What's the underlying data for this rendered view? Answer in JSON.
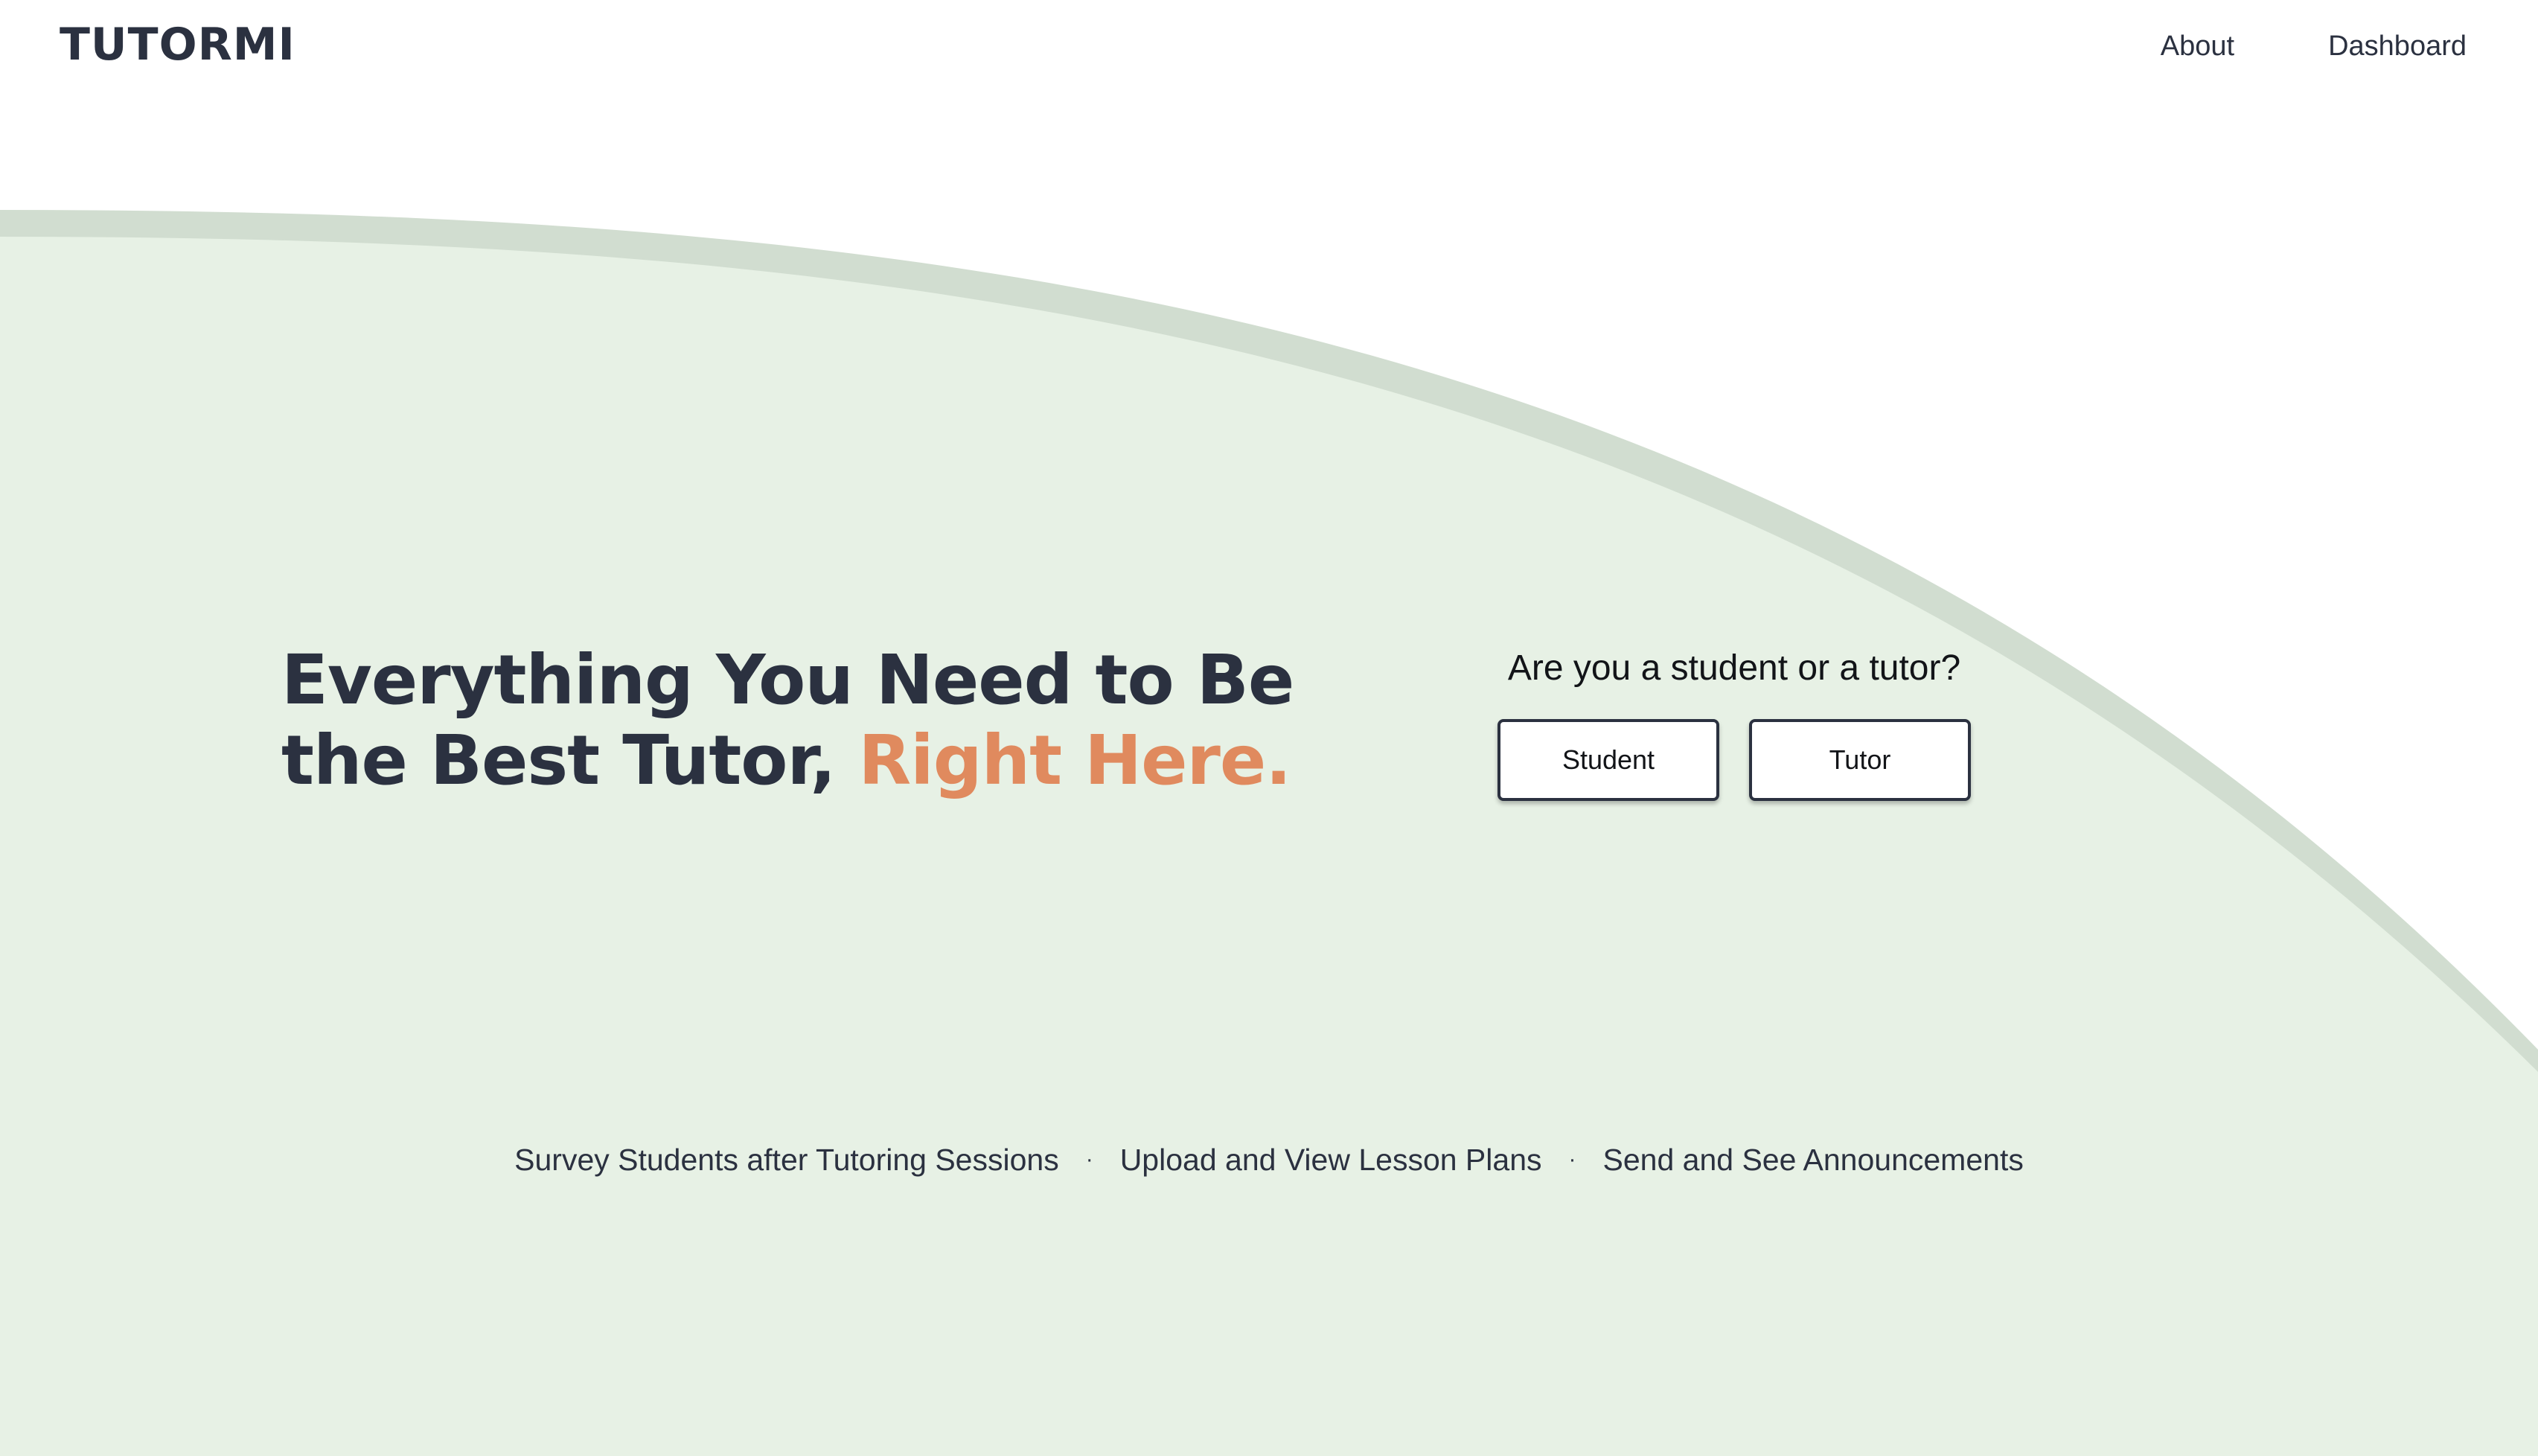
{
  "brand": {
    "logo_text": "TUTORMI"
  },
  "nav": {
    "links": [
      {
        "label": "About"
      },
      {
        "label": "Dashboard"
      }
    ]
  },
  "hero": {
    "title_main": "Everything You Need to Be the Best Tutor, ",
    "title_accent": "Right Here."
  },
  "role_choice": {
    "question": "Are you a student or a tutor?",
    "student_label": "Student",
    "tutor_label": "Tutor"
  },
  "features": {
    "items": [
      "Survey Students after Tutoring Sessions",
      "Upload and View Lesson Plans",
      "Send and See Announcements"
    ],
    "separator": "·"
  },
  "colors": {
    "background": "#ffffff",
    "hero_green": "#e7f1e5",
    "curve_border": "#d1ddd0",
    "text_dark": "#2b3140",
    "accent_orange": "#e08a5e"
  }
}
